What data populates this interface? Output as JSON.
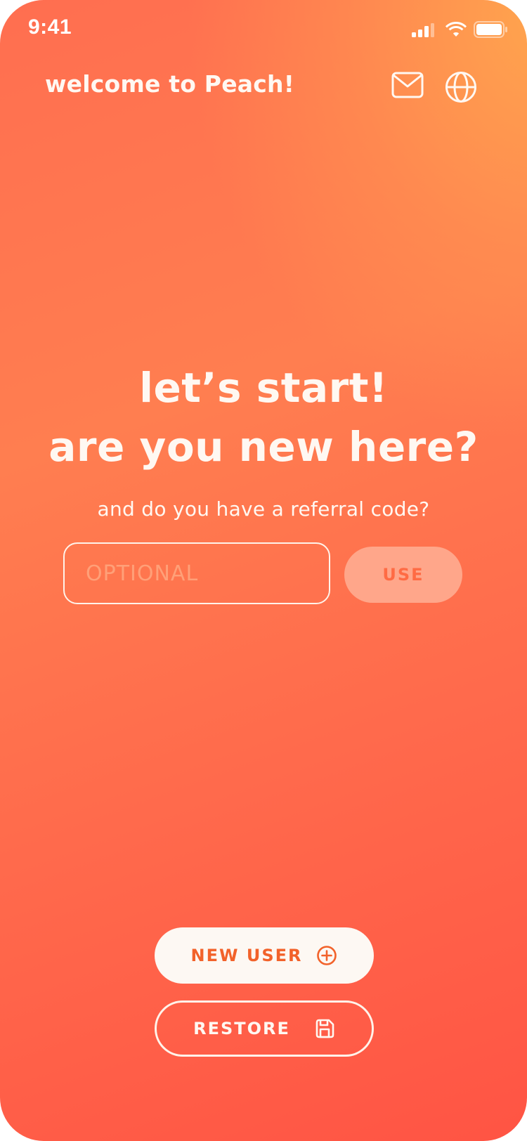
{
  "status_bar": {
    "time": "9:41",
    "icons": [
      "cellular-signal-icon",
      "wifi-icon",
      "battery-icon"
    ]
  },
  "header": {
    "title": "welcome to Peach!",
    "icons": [
      "mail-icon",
      "globe-icon"
    ]
  },
  "hero": {
    "line1": "let’s start!",
    "line2": "are you new here?"
  },
  "referral": {
    "prompt": "and do you have a referral code?",
    "input_value": "",
    "input_placeholder": "OPTIONAL",
    "use_label": "USE"
  },
  "actions": {
    "new_user_label": "NEW USER",
    "new_user_icon": "plus-circle-icon",
    "restore_label": "RESTORE",
    "restore_icon": "save-icon"
  },
  "colors": {
    "gradient_start": "#ff5444",
    "gradient_end": "#ffa34e",
    "text_light": "#fff8f2",
    "accent_text": "#f2622a",
    "use_button_bg": "#ffa68a"
  }
}
